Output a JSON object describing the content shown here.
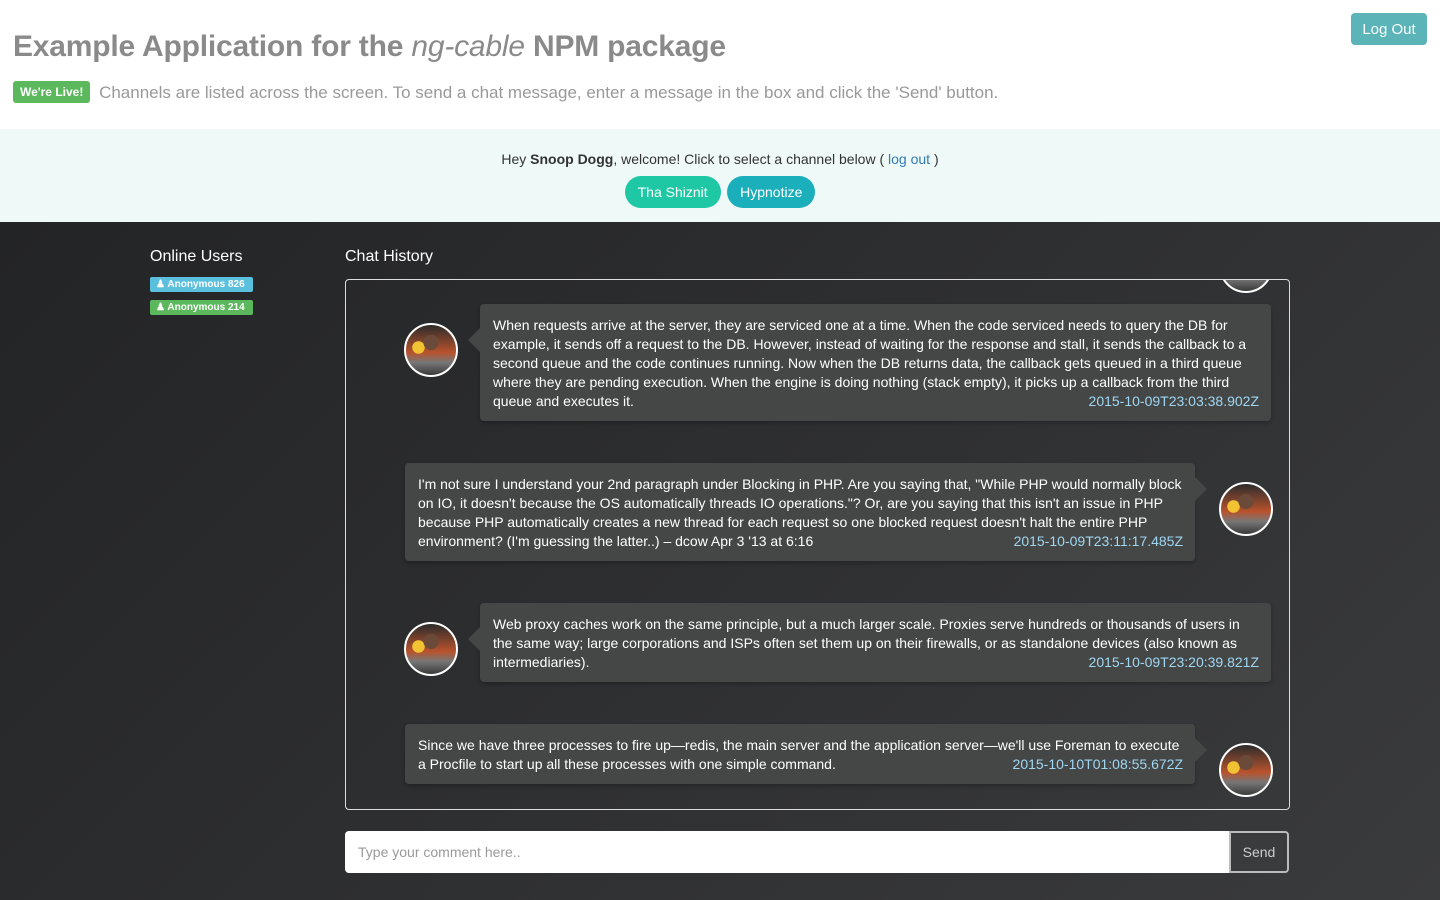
{
  "header": {
    "title_prefix": "Example Application for the ",
    "title_em": "ng-cable",
    "title_suffix": " NPM package",
    "live_badge": "We're Live!",
    "instructions": "Channels are listed across the screen. To send a chat message, enter a message in the box and click the 'Send' button.",
    "logout_label": "Log Out"
  },
  "welcome": {
    "prefix": "Hey ",
    "username": "Snoop Dogg",
    "middle": ", welcome! Click to select a channel below ( ",
    "logout_link": "log out",
    "suffix": " )",
    "channels": [
      {
        "label": "Tha Shiznit",
        "color": "#1fc8a5"
      },
      {
        "label": "Hypnotize",
        "color": "#1baebb"
      }
    ]
  },
  "sidebar": {
    "title": "Online Users",
    "users": [
      {
        "label": "Anonymous 826",
        "icon": "user-icon",
        "color": "#5bc0de"
      },
      {
        "label": "Anonymous 214",
        "icon": "user-icon",
        "color": "#5cb85c"
      }
    ]
  },
  "chat": {
    "title": "Chat History",
    "messages": [
      {
        "side": "left",
        "text": "When requests arrive at the server, they are serviced one at a time. When the code serviced needs to query the DB for example, it sends off a request to the DB. However, instead of waiting for the response and stall, it sends the callback to a second queue and the code continues running. Now when the DB returns data, the callback gets queued in a third queue where they are pending execution. When the engine is doing nothing (stack empty), it picks up a callback from the third queue and executes it.",
        "timestamp": "2015-10-09T23:03:38.902Z"
      },
      {
        "side": "right",
        "text": "I'm not sure I understand your 2nd paragraph under Blocking in PHP. Are you saying that, \"While PHP would normally block on IO, it doesn't because the OS automatically threads IO operations.\"? Or, are you saying that this isn't an issue in PHP because PHP automatically creates a new thread for each request so one blocked request doesn't halt the entire PHP environment? (I'm guessing the latter..) – dcow Apr 3 '13 at 6:16",
        "timestamp": "2015-10-09T23:11:17.485Z"
      },
      {
        "side": "left",
        "text": "Web proxy caches work on the same principle, but a much larger scale. Proxies serve hundreds or thousands of users in the same way; large corporations and ISPs often set them up on their firewalls, or as standalone devices (also known as intermediaries).",
        "timestamp": "2015-10-09T23:20:39.821Z"
      },
      {
        "side": "right",
        "text": "Since we have three processes to fire up—redis, the main server and the application server—we'll use Foreman to execute a Procfile to start up all these processes with one simple command.",
        "timestamp": "2015-10-10T01:08:55.672Z"
      }
    ]
  },
  "composer": {
    "placeholder": "Type your comment here..",
    "value": "",
    "send_label": "Send"
  }
}
